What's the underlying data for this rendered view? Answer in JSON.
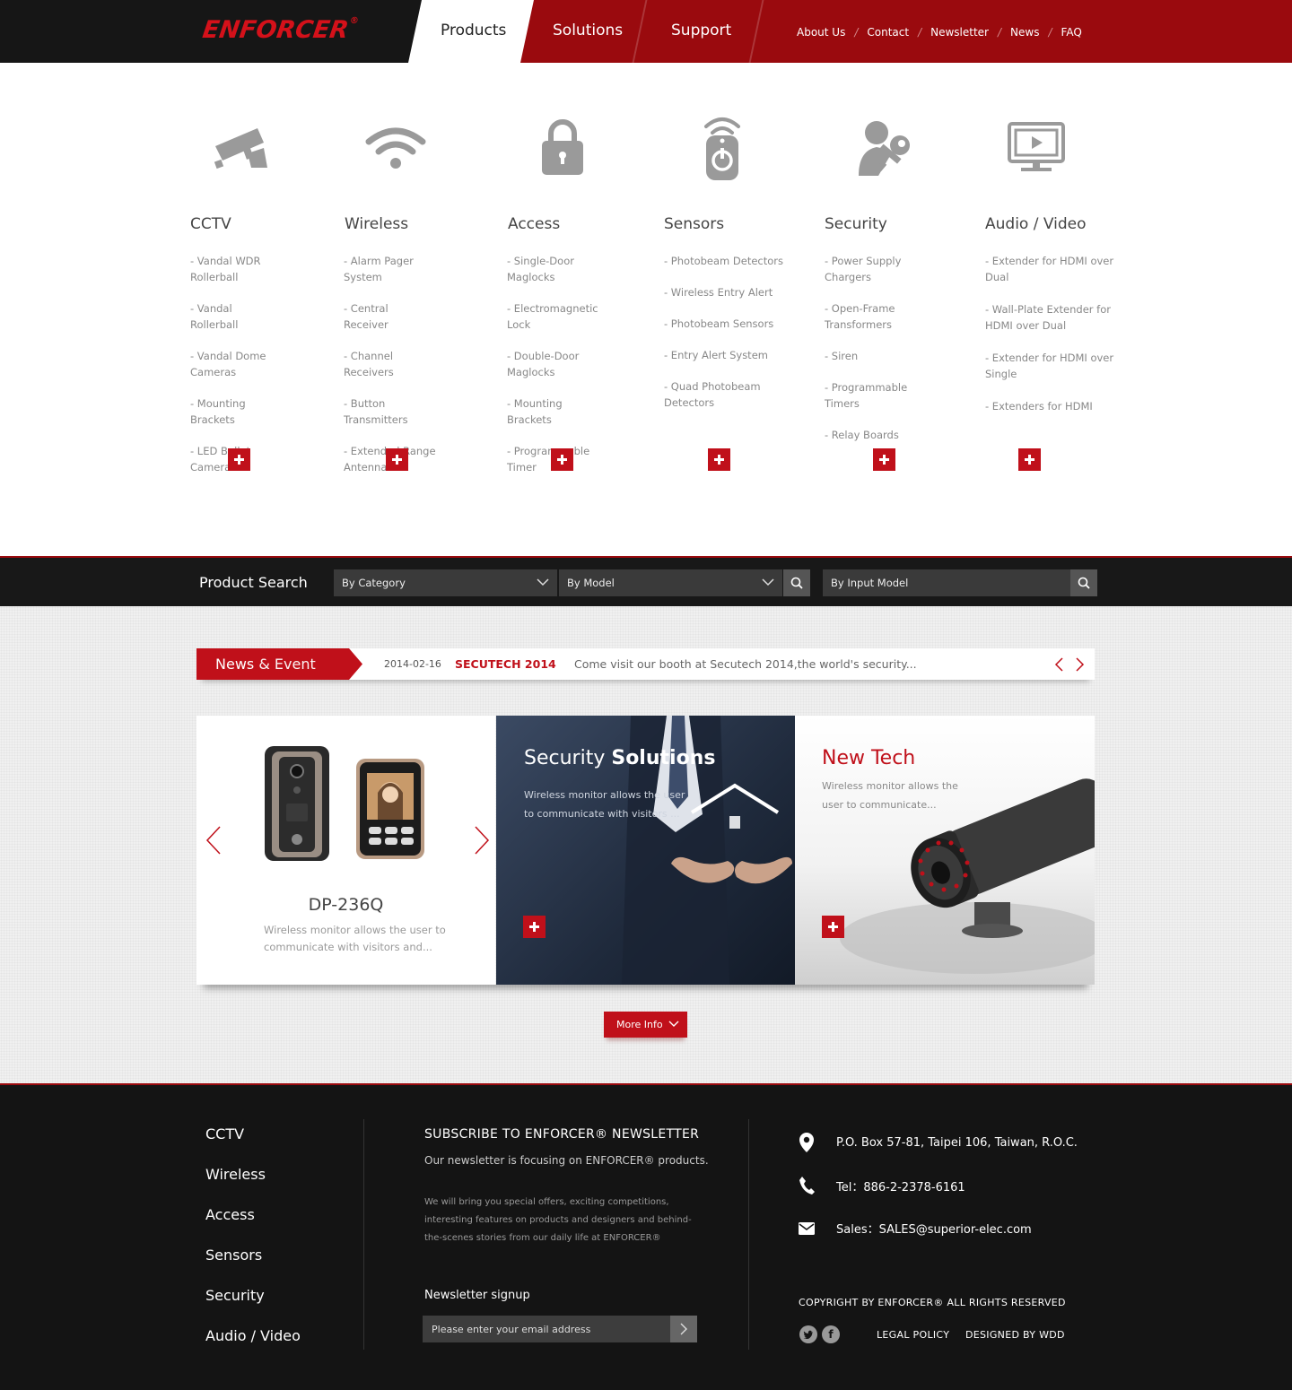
{
  "header": {
    "logo": "ENFORCER",
    "logo_mark": "®",
    "tabs": [
      {
        "label": "Products",
        "active": true
      },
      {
        "label": "Solutions"
      },
      {
        "label": "Support"
      }
    ],
    "top_links": [
      "About Us",
      "Contact",
      "Newsletter",
      "News",
      "FAQ"
    ],
    "top_link_separator": "/"
  },
  "categories": [
    {
      "icon": "cctv-camera-icon",
      "title": "CCTV",
      "items": [
        "- Vandal WDR Rollerball",
        "- Vandal Rollerball",
        "- Vandal Dome Cameras",
        "- Mounting Brackets",
        "- LED Bullet Camera"
      ]
    },
    {
      "icon": "wifi-icon",
      "title": "Wireless",
      "items": [
        "- Alarm Pager System",
        "- Central Receiver",
        "- Channel Receivers",
        "- Button Transmitters",
        "- Extended Range Antenna"
      ]
    },
    {
      "icon": "padlock-icon",
      "title": "Access",
      "items": [
        "- Single-Door Maglocks",
        "- Electromagnetic Lock",
        "- Double-Door Maglocks",
        "- Mounting Brackets",
        "- Programmable Timer"
      ]
    },
    {
      "icon": "remote-sensor-icon",
      "title": "Sensors",
      "items": [
        "- Photobeam Detectors",
        "- Wireless Entry Alert",
        "- Photobeam Sensors",
        "- Entry Alert System",
        "- Quad Photobeam Detectors"
      ]
    },
    {
      "icon": "person-key-icon",
      "title": "Security",
      "items": [
        "- Power Supply Chargers",
        "- Open-Frame Transformers",
        "- Siren",
        "- Programmable Timers",
        "- Relay Boards"
      ]
    },
    {
      "icon": "monitor-play-icon",
      "title": "Audio / Video",
      "items": [
        "- Extender for HDMI over Dual",
        "- Wall-Plate Extender for HDMI over Dual",
        "- Extender for HDMI over Single",
        "- Extenders for HDMI"
      ]
    }
  ],
  "search": {
    "label": "Product Search",
    "category_select": "By Category",
    "model_select": "By Model",
    "input_placeholder": "By Input Model"
  },
  "news": {
    "tag_main": "News",
    "tag_rest": "& Event",
    "date": "2014-02-16",
    "title": "SECUTECH 2014",
    "text": "Come visit our booth at Secutech 2014,the world's security..."
  },
  "panels": {
    "product": {
      "name": "DP-236Q",
      "desc": "Wireless monitor allows the user to communicate with visitors and..."
    },
    "solutions": {
      "title_light": "Security",
      "title_bold": "Solutions",
      "desc": "Wireless monitor allows the user to communicate with visitors ..."
    },
    "newtech": {
      "title": "New Tech",
      "desc": "Wireless monitor allows the user to communicate..."
    }
  },
  "more_info": "More Info",
  "footer": {
    "links": [
      "CCTV",
      "Wireless",
      "Access",
      "Sensors",
      "Security",
      "Audio / Video"
    ],
    "subscribe_title": "SUBSCRIBE TO ENFORCER® NEWSLETTER",
    "subscribe_line": "Our newsletter is focusing on ENFORCER® products.",
    "subscribe_body": "We will bring you special offers, exciting competitions, interesting features on products and designers and behind-the-scenes stories from our daily life at ENFORCER®",
    "signup_label": "Newsletter signup",
    "email_placeholder": "Please enter your email address",
    "address": "P.O. Box 57-81, Taipei 106, Taiwan, R.O.C.",
    "tel": "Tel：886-2-2378-6161",
    "sales": "Sales：SALES@superior-elec.com",
    "copyright": "COPYRIGHT BY ENFORCER® ALL RIGHTS RESERVED",
    "legal": "LEGAL POLICY",
    "designed": "DESIGNED BY WDD"
  },
  "colors": {
    "brand_red": "#c0101a",
    "header_red": "#9a0a0e",
    "dark": "#141414"
  }
}
